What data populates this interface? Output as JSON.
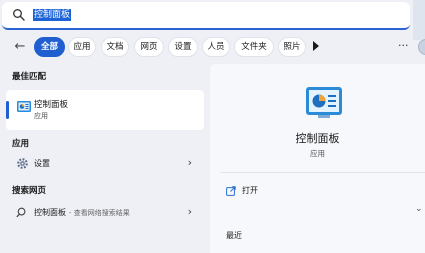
{
  "search": {
    "query": "控制面板"
  },
  "filters": {
    "back_label": "←",
    "tabs": [
      {
        "label": "全部",
        "active": true
      },
      {
        "label": "应用"
      },
      {
        "label": "文档"
      },
      {
        "label": "网页"
      },
      {
        "label": "设置"
      },
      {
        "label": "人员"
      },
      {
        "label": "文件夹"
      },
      {
        "label": "照片"
      }
    ],
    "more_label": "···"
  },
  "left": {
    "best_match_header": "最佳匹配",
    "best_match": {
      "title": "控制面板",
      "subtitle": "应用",
      "icon": "control-panel-icon"
    },
    "apps_header": "应用",
    "apps": [
      {
        "label": "设置",
        "icon": "gear-icon"
      }
    ],
    "web_header": "搜索网页",
    "web": [
      {
        "label": "控制面板",
        "hint": "- 查看网络搜索结果",
        "icon": "search-icon"
      }
    ]
  },
  "right": {
    "title": "控制面板",
    "subtitle": "应用",
    "open_label": "打开",
    "recent_label": "最近",
    "icon": "control-panel-icon"
  },
  "colors": {
    "accent": "#1f5fd0",
    "background": "#eef0f6"
  }
}
